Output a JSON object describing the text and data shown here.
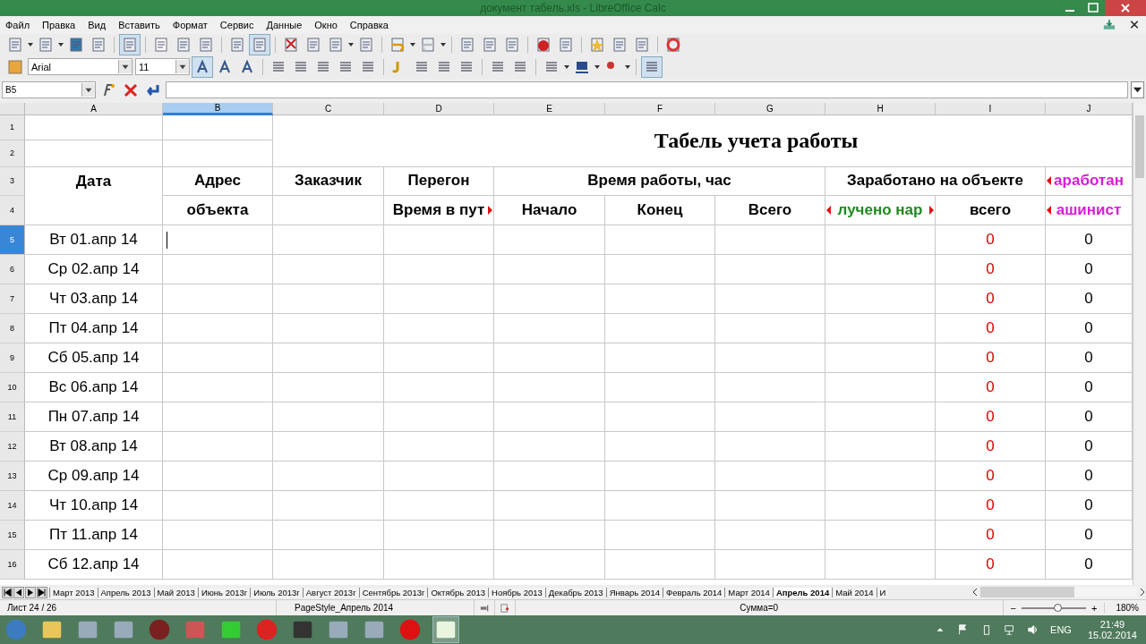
{
  "window": {
    "title": "документ табель.xls - LibreOffice Calc"
  },
  "menu": [
    "Файл",
    "Правка",
    "Вид",
    "Вставить",
    "Формат",
    "Сервис",
    "Данные",
    "Окно",
    "Справка"
  ],
  "format_bar": {
    "font_name": "Arial",
    "font_size": "11"
  },
  "formula_bar": {
    "name_box": "B5"
  },
  "sheet": {
    "columns": [
      {
        "letter": "A",
        "selected": false
      },
      {
        "letter": "B",
        "selected": true
      },
      {
        "letter": "C",
        "selected": false
      },
      {
        "letter": "D",
        "selected": false
      },
      {
        "letter": "E",
        "selected": false
      },
      {
        "letter": "F",
        "selected": false
      },
      {
        "letter": "G",
        "selected": false
      },
      {
        "letter": "H",
        "selected": false
      },
      {
        "letter": "I",
        "selected": false
      },
      {
        "letter": "J",
        "selected": false
      }
    ],
    "header_rows": [
      "1",
      "2",
      "3",
      "4"
    ],
    "header_cells": [
      {
        "text": "Табель учета работы",
        "kind": "title",
        "color": "#000000",
        "clipped_left": false,
        "clipped_right": false
      },
      {
        "text": "Дата",
        "kind": "heading",
        "color": "#000000",
        "clipped_left": false,
        "clipped_right": false
      },
      {
        "text": "Адрес",
        "kind": "heading",
        "color": "#000000",
        "clipped_left": false,
        "clipped_right": false
      },
      {
        "text": "Заказчик",
        "kind": "heading",
        "color": "#000000",
        "clipped_left": false,
        "clipped_right": false
      },
      {
        "text": "Перегон",
        "kind": "heading",
        "color": "#000000",
        "clipped_left": false,
        "clipped_right": false
      },
      {
        "text": "Время работы, час",
        "kind": "heading",
        "color": "#000000",
        "clipped_left": false,
        "clipped_right": false
      },
      {
        "text": "Заработано на объекте",
        "kind": "heading",
        "color": "#000000",
        "clipped_left": false,
        "clipped_right": false
      },
      {
        "text": "аработан",
        "kind": "heading",
        "color": "#d81bd8",
        "clipped_left": true,
        "clipped_right": false
      },
      {
        "text": "объекта",
        "kind": "heading",
        "color": "#000000",
        "clipped_left": false,
        "clipped_right": false
      },
      {
        "text": "Время в пут",
        "kind": "heading",
        "color": "#000000",
        "clipped_left": false,
        "clipped_right": true
      },
      {
        "text": "Начало",
        "kind": "heading",
        "color": "#000000",
        "clipped_left": false,
        "clipped_right": false
      },
      {
        "text": "Конец",
        "kind": "heading",
        "color": "#000000",
        "clipped_left": false,
        "clipped_right": false
      },
      {
        "text": "Всего",
        "kind": "heading",
        "color": "#000000",
        "clipped_left": false,
        "clipped_right": false
      },
      {
        "text": "лучено нар",
        "kind": "heading",
        "color": "#1f8a1f",
        "clipped_left": true,
        "clipped_right": true
      },
      {
        "text": "всего",
        "kind": "heading",
        "color": "#000000",
        "clipped_left": false,
        "clipped_right": false
      },
      {
        "text": "ашинист",
        "kind": "heading",
        "color": "#d81bd8",
        "clipped_left": true,
        "clipped_right": false
      }
    ],
    "rows": [
      {
        "number": "5",
        "selected": true,
        "date": "Вт 01.апр 14",
        "earned": "0",
        "machinist": "0"
      },
      {
        "number": "6",
        "selected": false,
        "date": "Ср 02.апр 14",
        "earned": "0",
        "machinist": "0"
      },
      {
        "number": "7",
        "selected": false,
        "date": "Чт 03.апр 14",
        "earned": "0",
        "machinist": "0"
      },
      {
        "number": "8",
        "selected": false,
        "date": "Пт 04.апр 14",
        "earned": "0",
        "machinist": "0"
      },
      {
        "number": "9",
        "selected": false,
        "date": "Сб 05.апр 14",
        "earned": "0",
        "machinist": "0"
      },
      {
        "number": "10",
        "selected": false,
        "date": "Вс 06.апр 14",
        "earned": "0",
        "machinist": "0"
      },
      {
        "number": "11",
        "selected": false,
        "date": "Пн 07.апр 14",
        "earned": "0",
        "machinist": "0"
      },
      {
        "number": "12",
        "selected": false,
        "date": "Вт 08.апр 14",
        "earned": "0",
        "machinist": "0"
      },
      {
        "number": "13",
        "selected": false,
        "date": "Ср 09.апр 14",
        "earned": "0",
        "machinist": "0"
      },
      {
        "number": "14",
        "selected": false,
        "date": "Чт 10.апр 14",
        "earned": "0",
        "machinist": "0"
      },
      {
        "number": "15",
        "selected": false,
        "date": "Пт 11.апр 14",
        "earned": "0",
        "machinist": "0"
      },
      {
        "number": "16",
        "selected": false,
        "date": "Сб 12.апр 14",
        "earned": "0",
        "machinist": "0"
      }
    ]
  },
  "sheet_tabs": [
    {
      "label": "Март 2013",
      "selected": false
    },
    {
      "label": "Апрель 2013",
      "selected": false
    },
    {
      "label": "Май 2013",
      "selected": false
    },
    {
      "label": "Июнь 2013г",
      "selected": false
    },
    {
      "label": "Июль 2013г",
      "selected": false
    },
    {
      "label": "Август 2013г",
      "selected": false
    },
    {
      "label": "Сентябрь 2013г",
      "selected": false
    },
    {
      "label": "Октябрь 2013",
      "selected": false
    },
    {
      "label": "Ноябрь 2013",
      "selected": false
    },
    {
      "label": "Декабрь 2013",
      "selected": false
    },
    {
      "label": "Январь 2014",
      "selected": false
    },
    {
      "label": "Февраль 2014",
      "selected": false
    },
    {
      "label": "Март 2014",
      "selected": false
    },
    {
      "label": "Апрель 2014",
      "selected": true
    },
    {
      "label": "Май 2014",
      "selected": false
    },
    {
      "label": "И",
      "selected": false
    }
  ],
  "status_bar": {
    "sheet": "Лист 24 / 26",
    "page_style": "PageStyle_Апрель 2014",
    "sum": "Сумма=0",
    "zoom_minus": "−",
    "zoom_plus": "+",
    "zoom": {
      "level": 0.55
    },
    "zoom_value": "180%"
  },
  "taskbar": {
    "language": "ENG",
    "time": "21:49",
    "date": "15.02.2014"
  }
}
